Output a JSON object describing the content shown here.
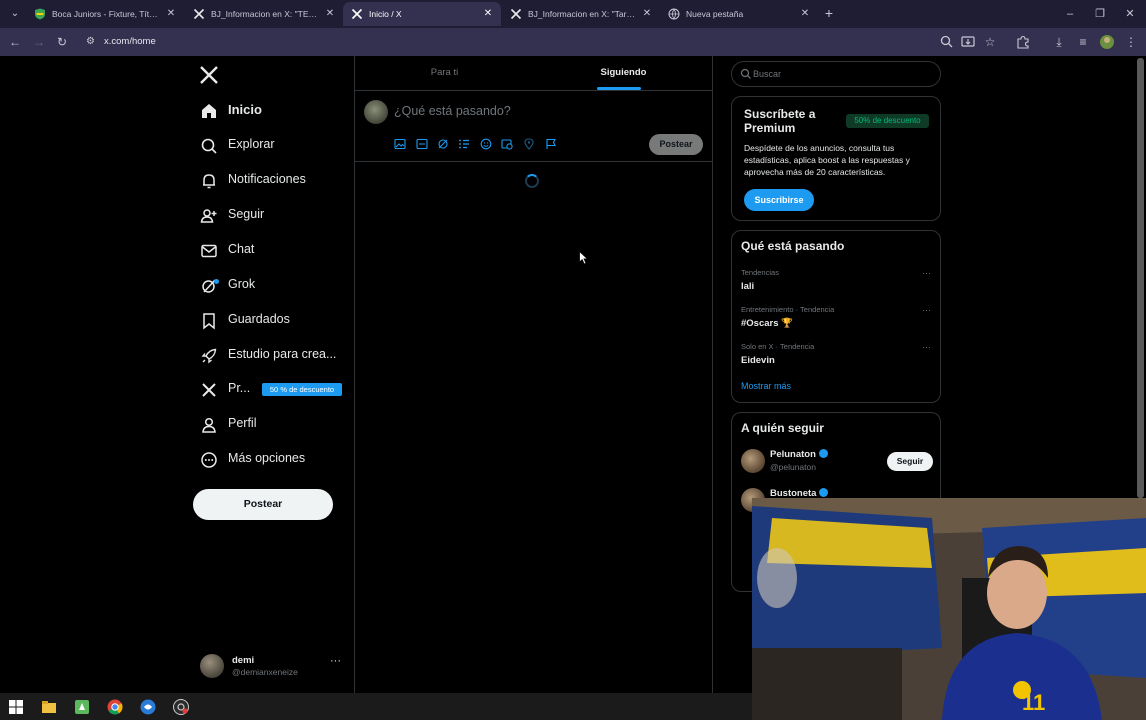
{
  "browser": {
    "tabs": [
      {
        "title": "Boca Juniors - Fixture, Títulos y"
      },
      {
        "title": "BJ_Informacion en X: \"TERMINÓ"
      },
      {
        "title": "Inicio / X"
      },
      {
        "title": "BJ_Informacion en X: \"Tarragona"
      },
      {
        "title": "Nueva pestaña"
      }
    ],
    "url": "x.com/home"
  },
  "sidebar": {
    "items": [
      {
        "label": "Inicio",
        "icon": "home-icon"
      },
      {
        "label": "Explorar",
        "icon": "search-icon"
      },
      {
        "label": "Notificaciones",
        "icon": "bell-icon"
      },
      {
        "label": "Seguir",
        "icon": "follow-icon"
      },
      {
        "label": "Chat",
        "icon": "mail-icon"
      },
      {
        "label": "Grok",
        "icon": "grok-icon"
      },
      {
        "label": "Guardados",
        "icon": "bookmark-icon"
      },
      {
        "label": "Estudio para crea...",
        "icon": "rocket-icon"
      },
      {
        "label": "Pr...",
        "icon": "x-premium-icon"
      },
      {
        "label": "Perfil",
        "icon": "person-icon"
      },
      {
        "label": "Más opciones",
        "icon": "more-circle-icon"
      }
    ],
    "premium_badge": "50 % de descuento",
    "post_label": "Postear",
    "account": {
      "name": "demi",
      "handle": "@demianxeneize"
    }
  },
  "feed": {
    "tabs": [
      "Para ti",
      "Siguiendo"
    ],
    "compose_placeholder": "¿Qué está pasando?",
    "post_label": "Postear"
  },
  "right": {
    "search_placeholder": "Buscar",
    "premium": {
      "title": "Suscríbete a Premium",
      "badge": "50% de descuento",
      "desc": "Despídete de los anuncios, consulta tus estadísticas, aplica boost a las respuestas y aprovecha más de 20 características.",
      "button": "Suscribirse"
    },
    "trends": {
      "heading": "Qué está pasando",
      "items": [
        {
          "category": "Tendencias",
          "name": "lali"
        },
        {
          "category": "Entretenimiento · Tendencia",
          "name": "#Oscars 🏆"
        },
        {
          "category": "Solo en X · Tendencia",
          "name": "Eidevin"
        }
      ],
      "more": "Mostrar más"
    },
    "follow": {
      "heading": "A quién seguir",
      "items": [
        {
          "name": "Pelunaton",
          "handle": "@pelunaton",
          "button": "Seguir"
        },
        {
          "name": "Bustoneta",
          "handle": "",
          "button": ""
        }
      ]
    }
  }
}
